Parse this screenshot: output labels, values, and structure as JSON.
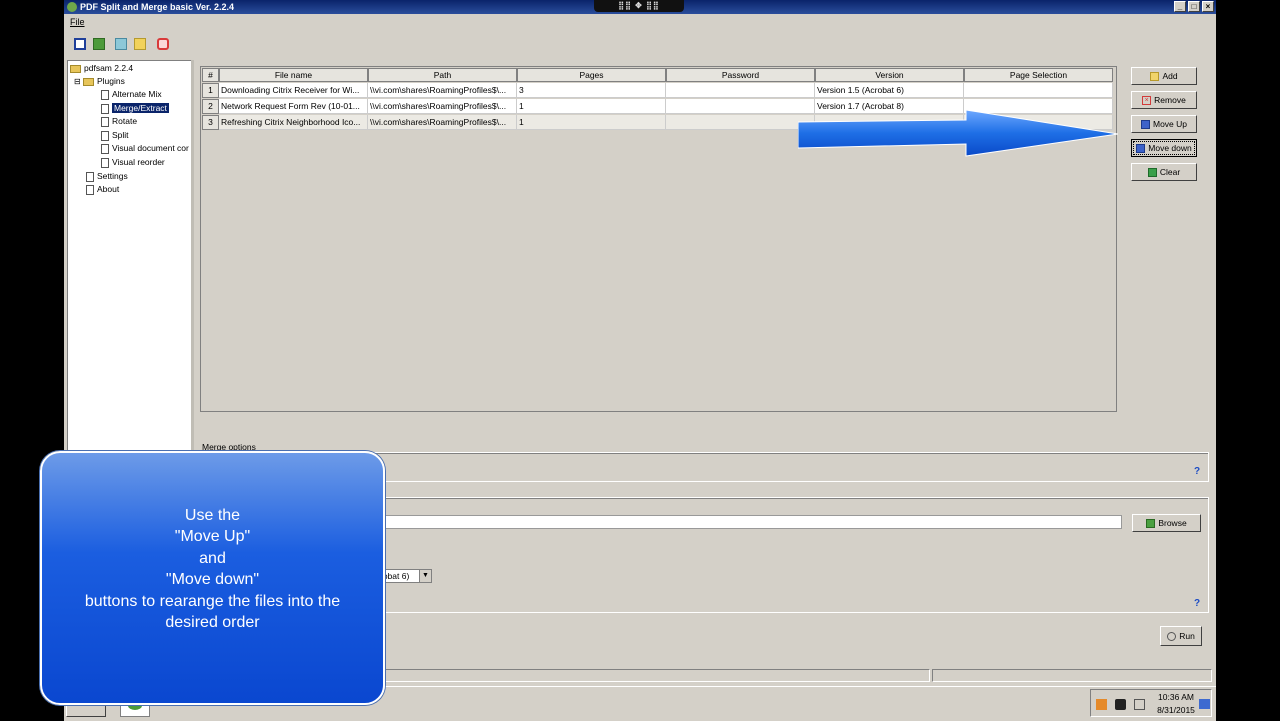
{
  "window": {
    "title": "PDF Split and Merge basic Ver. 2.2.4",
    "notch": "⣿⣿ ✥ ⣿⣿"
  },
  "titlebar_buttons": {
    "minimize": "_",
    "maximize": "□",
    "close": "×"
  },
  "menu": {
    "file": "File"
  },
  "tree": {
    "root": "pdfsam 2.2.4",
    "plugins": "Plugins",
    "items": [
      "Alternate Mix",
      "Merge/Extract",
      "Rotate",
      "Split",
      "Visual document cor",
      "Visual reorder"
    ],
    "settings": "Settings",
    "about": "About"
  },
  "table": {
    "columns": [
      "#",
      "File name",
      "Path",
      "Pages",
      "Password",
      "Version",
      "Page Selection"
    ],
    "rows": [
      {
        "num": "1",
        "file": "Downloading Citrix Receiver for Wi...",
        "path": "\\\\vi.com\\shares\\RoamingProfiles$\\...",
        "pages": "3",
        "password": "",
        "version": "Version 1.5 (Acrobat 6)",
        "selection": ""
      },
      {
        "num": "2",
        "file": "Network Request Form Rev (10-01...",
        "path": "\\\\vi.com\\shares\\RoamingProfiles$\\...",
        "pages": "1",
        "password": "",
        "version": "Version 1.7 (Acrobat 8)",
        "selection": ""
      },
      {
        "num": "3",
        "file": "Refreshing Citrix Neighborhood Ico...",
        "path": "\\\\vi.com\\shares\\RoamingProfiles$\\...",
        "pages": "1",
        "password": "",
        "version": "",
        "selection": ""
      }
    ]
  },
  "side_buttons": {
    "add": "Add",
    "remove": "Remove",
    "move_up": "Move Up",
    "move_down": "Move down",
    "clear": "Clear"
  },
  "merge_options": {
    "label": "Merge options"
  },
  "destination": {
    "browse": "Browse",
    "version_value": "robat 6)"
  },
  "run": {
    "label": "Run"
  },
  "help": "?",
  "callout": {
    "lines": [
      "Use the",
      "\"Move Up\"",
      "and",
      "\"Move down\"",
      "buttons to rearange the files into the",
      "desired order"
    ]
  },
  "clock": {
    "time": "10:36 AM",
    "date": "8/31/2015"
  },
  "colors": {
    "title_bar": "#0a246a",
    "callout": "#1b5ee0",
    "arrow": "#1e6fe6",
    "selection": "#0a246a"
  }
}
